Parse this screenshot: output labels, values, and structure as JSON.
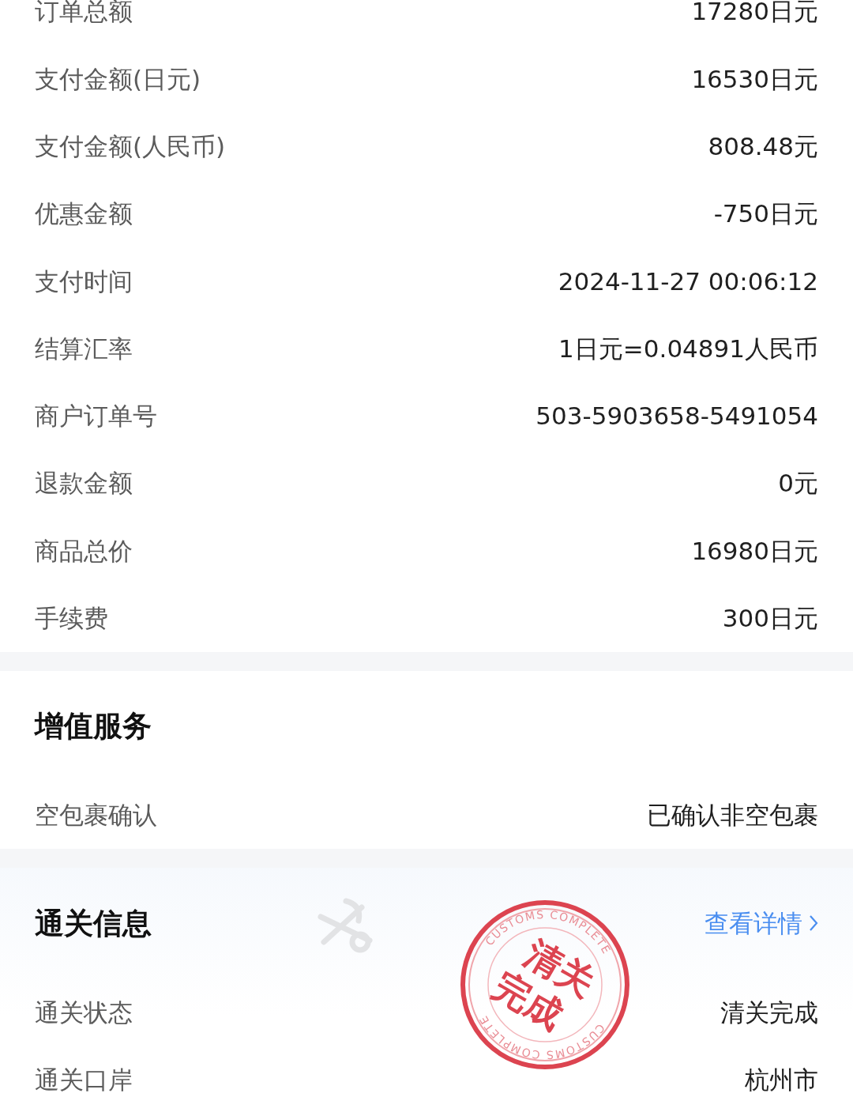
{
  "fee_rows": [
    {
      "label": "订单总额",
      "value": "17280日元"
    },
    {
      "label": "支付金额(日元)",
      "value": "16530日元"
    },
    {
      "label": "支付金额(人民币)",
      "value": "808.48元"
    },
    {
      "label": "优惠金额",
      "value": "-750日元"
    },
    {
      "label": "支付时间",
      "value": "2024-11-27 00:06:12"
    },
    {
      "label": "结算汇率",
      "value": "1日元=0.04891人民币"
    },
    {
      "label": "商户订单号",
      "value": "503-5903658-5491054"
    },
    {
      "label": "退款金额",
      "value": "0元"
    },
    {
      "label": "商品总价",
      "value": "16980日元"
    },
    {
      "label": "手续费",
      "value": "300日元"
    }
  ],
  "sections": [
    {
      "kind": "plain",
      "title": "增值服务",
      "rows": [
        {
          "label": "空包裹确认",
          "value": "已确认非空包裹"
        }
      ]
    },
    {
      "kind": "customs",
      "title": "通关信息",
      "link": "查看详情",
      "rows": [
        {
          "label": "通关状态",
          "value": "清关完成"
        },
        {
          "label": "通关口岸",
          "value": "杭州市"
        }
      ],
      "stamp": {
        "lines": [
          "清关",
          "完成"
        ],
        "ring_texts": [
          "CUSTOMS COMPLETE",
          "CUSTOMS COMPLETE"
        ]
      }
    }
  ]
}
